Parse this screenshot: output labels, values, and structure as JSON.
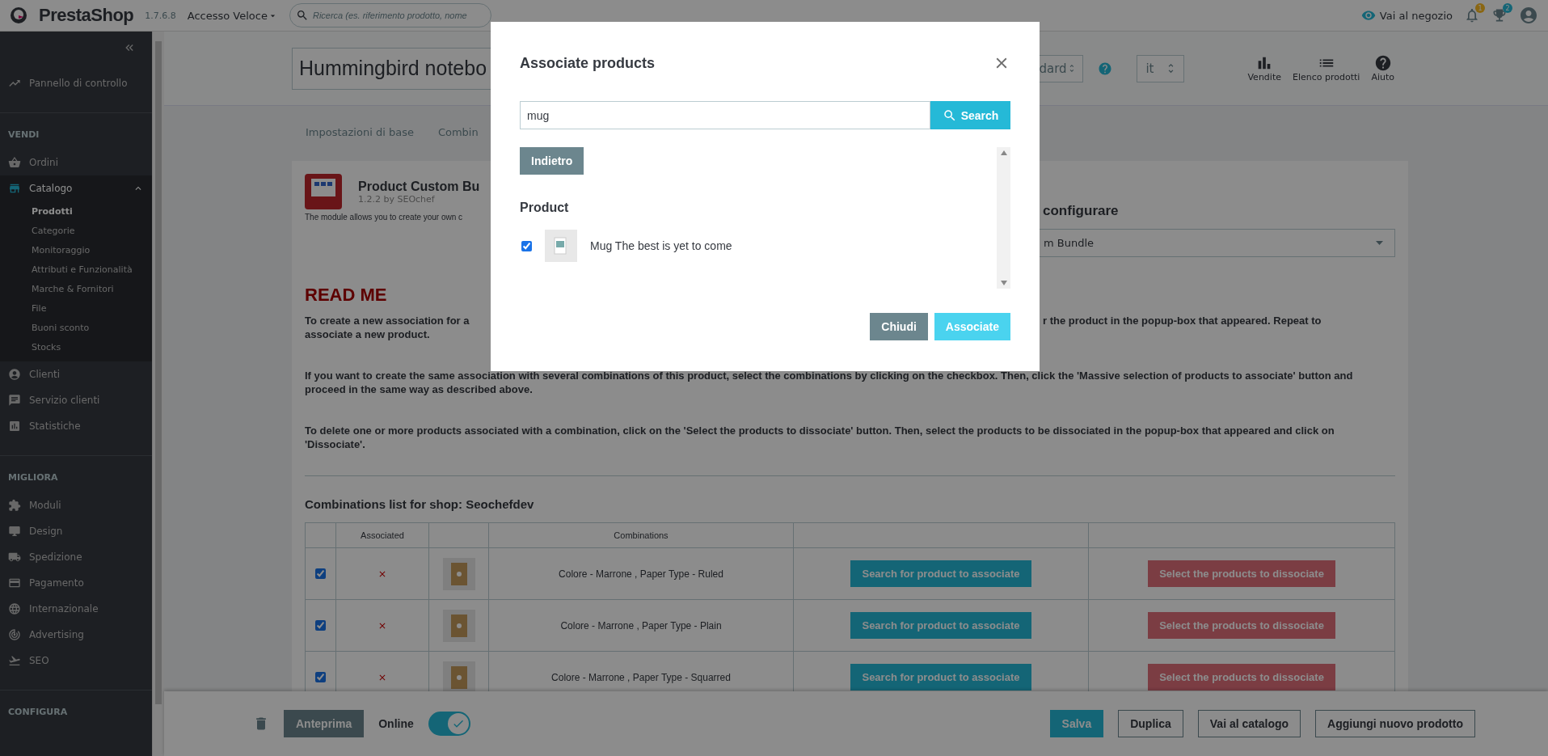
{
  "topbar": {
    "logo": "PrestaShop",
    "version": "1.7.6.8",
    "quick_access": "Accesso Veloce",
    "search_placeholder": "Ricerca (es. riferimento prodotto, nome",
    "store_link": "Vai al negozio",
    "badges": [
      "1",
      "2"
    ]
  },
  "sidebar": {
    "dashboard": "Pannello di controllo",
    "sections": [
      {
        "title": "VENDI",
        "items": [
          {
            "label": "Ordini",
            "selected": false
          },
          {
            "label": "Catalogo",
            "selected": true,
            "expanded": true,
            "children": [
              {
                "label": "Prodotti",
                "selected": true
              },
              {
                "label": "Categorie",
                "selected": false
              },
              {
                "label": "Monitoraggio",
                "selected": false
              },
              {
                "label": "Attributi e Funzionalità",
                "selected": false
              },
              {
                "label": "Marche & Fornitori",
                "selected": false
              },
              {
                "label": "File",
                "selected": false
              },
              {
                "label": "Buoni sconto",
                "selected": false
              },
              {
                "label": "Stocks",
                "selected": false
              }
            ]
          },
          {
            "label": "Clienti",
            "selected": false
          },
          {
            "label": "Servizio clienti",
            "selected": false
          },
          {
            "label": "Statistiche",
            "selected": false
          }
        ]
      },
      {
        "title": "MIGLIORA",
        "items": [
          {
            "label": "Moduli",
            "selected": false
          },
          {
            "label": "Design",
            "selected": false
          },
          {
            "label": "Spedizione",
            "selected": false
          },
          {
            "label": "Pagamento",
            "selected": false
          },
          {
            "label": "Internazionale",
            "selected": false
          },
          {
            "label": "Advertising",
            "selected": false
          },
          {
            "label": "SEO",
            "selected": false
          }
        ]
      },
      {
        "title": "CONFIGURA"
      }
    ]
  },
  "product_header": {
    "name": "Hummingbird notebo",
    "type_select": "dard",
    "language": "it",
    "actions": [
      "Vendite",
      "Elenco prodotti",
      "Aiuto"
    ]
  },
  "tabs": [
    {
      "label": "Impostazioni di base",
      "selected": false
    },
    {
      "label": "Combin",
      "selected": false
    }
  ],
  "module": {
    "name": "Product Custom Bu",
    "version": "1.2.2 by SEOchef",
    "description": "The module allows you to create your own c",
    "config_title": "configurare",
    "config_select": "m Bundle"
  },
  "readme": {
    "title": "READ ME",
    "first_left": "To create a new association for a",
    "first_right": "r the product in the popup-box that appeared. Repeat to",
    "first_continued": "associate a new product.",
    "paragraphs": [
      "If you want to create the same association with several combinations of this product, select the combinations by clicking on the checkbox. Then, click the 'Massive selection of products to associate' button and proceed in the same way as described above.",
      "To delete one or more products associated with a combination, click on the 'Select the products to dissociate' button. Then, select the products to be dissociated in the popup-box that appeared and click on 'Dissociate'."
    ]
  },
  "combinations": {
    "title": "Combinations list for shop: Seochefdev",
    "columns": [
      "Associated",
      "Combinations"
    ],
    "rows": [
      {
        "checked": true,
        "associated": false,
        "combination": "Colore - Marrone ,  Paper Type - Ruled",
        "associate_button": "Search for product to associate",
        "dissociate_button": "Select the products to dissociate"
      },
      {
        "checked": true,
        "associated": false,
        "combination": "Colore - Marrone ,  Paper Type - Plain",
        "associate_button": "Search for product to associate",
        "dissociate_button": "Select the products to dissociate"
      },
      {
        "checked": true,
        "associated": false,
        "combination": "Colore - Marrone ,  Paper Type - Squarred",
        "associate_button": "Search for product to associate",
        "dissociate_button": "Select the products to dissociate"
      }
    ]
  },
  "footer": {
    "preview": "Anteprima",
    "online_label": "Online",
    "online": true,
    "buttons": [
      "Salva",
      "Duplica",
      "Vai al catalogo",
      "Aggiungi nuovo prodotto"
    ]
  },
  "modal": {
    "title": "Associate products",
    "search_value": "mug",
    "search_button": "Search",
    "back_button": "Indietro",
    "section": "Product",
    "results": [
      {
        "name": "Mug The best is yet to come",
        "checked": true
      }
    ],
    "buttons": [
      "Chiudi",
      "Associate"
    ]
  }
}
